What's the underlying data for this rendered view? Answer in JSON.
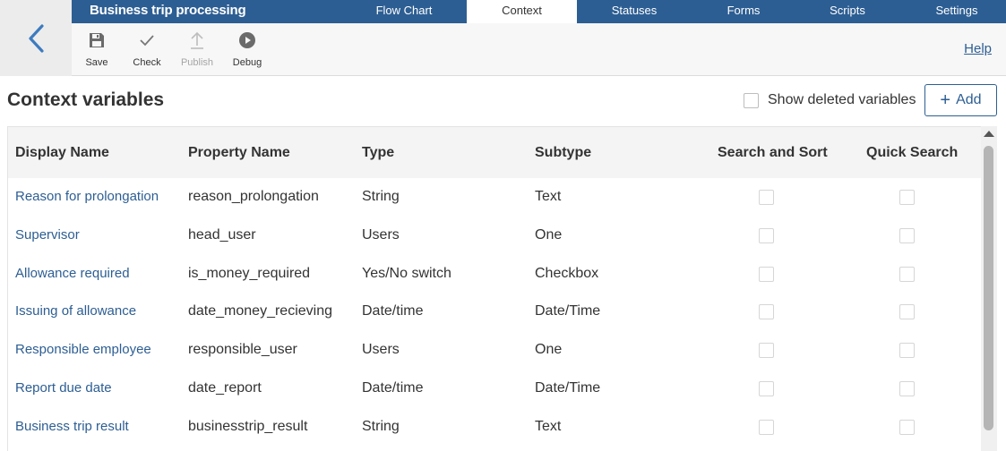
{
  "header": {
    "title": "Business trip processing",
    "tabs": [
      "Flow Chart",
      "Context",
      "Statuses",
      "Forms",
      "Scripts",
      "Settings"
    ],
    "active_tab": "Context"
  },
  "toolbar": {
    "save": "Save",
    "check": "Check",
    "publish": "Publish",
    "debug": "Debug",
    "help": "Help"
  },
  "page": {
    "title": "Context variables",
    "show_deleted": "Show deleted variables",
    "add": "Add"
  },
  "table": {
    "columns": [
      "Display Name",
      "Property Name",
      "Type",
      "Subtype",
      "Search and Sort",
      "Quick Search"
    ],
    "rows": [
      {
        "display": "Reason for prolongation",
        "property": "reason_prolongation",
        "type": "String",
        "subtype": "Text"
      },
      {
        "display": "Supervisor",
        "property": "head_user",
        "type": "Users",
        "subtype": "One"
      },
      {
        "display": "Allowance required",
        "property": "is_money_required",
        "type": "Yes/No switch",
        "subtype": "Checkbox"
      },
      {
        "display": "Issuing of allowance",
        "property": "date_money_recieving",
        "type": "Date/time",
        "subtype": "Date/Time"
      },
      {
        "display": "Responsible employee",
        "property": "responsible_user",
        "type": "Users",
        "subtype": "One"
      },
      {
        "display": "Report due date",
        "property": "date_report",
        "type": "Date/time",
        "subtype": "Date/Time"
      },
      {
        "display": "Business trip result",
        "property": "businesstrip_result",
        "type": "String",
        "subtype": "Text"
      }
    ]
  },
  "colors": {
    "primary": "#2d5e93",
    "header_bg": "#f4f4f4",
    "toolbar_bg": "#f7f7f7"
  }
}
